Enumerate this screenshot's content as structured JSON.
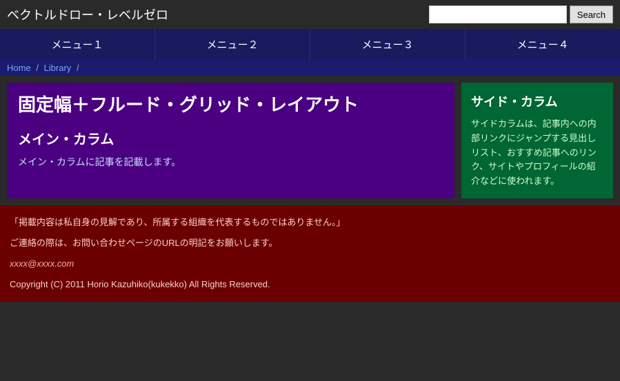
{
  "header": {
    "site_title": "ベクトルドロー・レベルゼロ",
    "search_placeholder": "",
    "search_button_label": "Search"
  },
  "nav": {
    "items": [
      {
        "label": "メニュー１"
      },
      {
        "label": "メニュー２"
      },
      {
        "label": "メニュー３"
      },
      {
        "label": "メニュー４"
      }
    ]
  },
  "breadcrumb": {
    "home": "Home",
    "separator1": "/",
    "library": "Library",
    "separator2": "/"
  },
  "main": {
    "heading": "固定幅＋フルード・グリッド・レイアウト",
    "subheading": "メイン・カラム",
    "text": "メイン・カラムに記事を記載します。"
  },
  "sidebar": {
    "heading": "サイド・カラム",
    "text": "サイドカラムは、記事内への内部リンクにジャンプする見出しリスト、おすすめ記事へのリンク、サイトやプロフィールの紹介などに使われます。"
  },
  "footer": {
    "disclaimer": "「掲載内容は私自身の見解であり、所属する組織を代表するものではありません。」",
    "contact": "ご連絡の際は、お問い合わせページのURLの明記をお願いします。",
    "email": "xxxx@xxxx.com",
    "copyright": "Copyright (C) 2011 Horio Kazuhiko(kukekko) All Rights Reserved."
  }
}
